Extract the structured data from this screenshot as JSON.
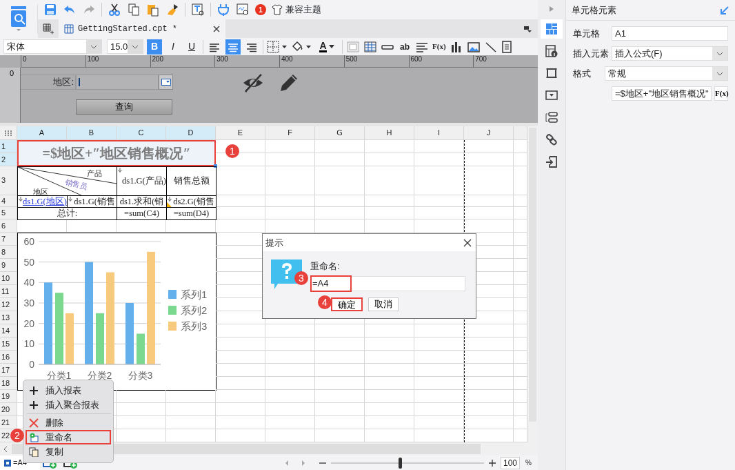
{
  "toolbar": {
    "badge": "1",
    "theme_button": "兼容主题"
  },
  "tabs": [
    {
      "label": "GettingStarted.cpt *",
      "selected": true
    }
  ],
  "format_bar": {
    "font": "宋体",
    "font_size": "15.0",
    "style_buttons": [
      {
        "kind": "bold",
        "label": "B",
        "selected": true
      },
      {
        "kind": "italic",
        "label": "I",
        "selected": false
      },
      {
        "kind": "underline",
        "label": "U",
        "selected": false
      }
    ],
    "align_buttons": [
      {
        "kind": "left",
        "selected": false
      },
      {
        "kind": "center",
        "selected": true
      },
      {
        "kind": "right",
        "selected": false
      }
    ],
    "font_color_label": "A",
    "text_label": "ab",
    "formula_label": "F(x)"
  },
  "ruler": {
    "ticks": [
      "0",
      "100",
      "200",
      "300",
      "400",
      "500",
      "600",
      "700"
    ],
    "vertical_ticks": [
      "0"
    ]
  },
  "parameter_pane": {
    "label": "地区:",
    "query_button": "查询"
  },
  "sheet": {
    "columns": [
      {
        "label": "A",
        "selected": true
      },
      {
        "label": "B",
        "selected": true
      },
      {
        "label": "C",
        "selected": true
      },
      {
        "label": "D",
        "selected": true
      },
      {
        "label": "E",
        "selected": false
      },
      {
        "label": "F",
        "selected": false
      },
      {
        "label": "G",
        "selected": false
      },
      {
        "label": "H",
        "selected": false
      },
      {
        "label": "I",
        "selected": false
      },
      {
        "label": "J",
        "selected": false
      }
    ],
    "rows": [
      {
        "label": "1",
        "selected": true
      },
      {
        "label": "2",
        "selected": true
      },
      {
        "label": "3",
        "selected": false
      },
      {
        "label": "4",
        "selected": false
      },
      {
        "label": "5",
        "selected": false
      },
      {
        "label": "6",
        "selected": false
      },
      {
        "label": "7",
        "selected": false
      },
      {
        "label": "8",
        "selected": false
      },
      {
        "label": "9",
        "selected": false
      },
      {
        "label": "10",
        "selected": false
      },
      {
        "label": "11",
        "selected": false
      },
      {
        "label": "12",
        "selected": false
      },
      {
        "label": "13",
        "selected": false
      },
      {
        "label": "14",
        "selected": false
      },
      {
        "label": "15",
        "selected": false
      },
      {
        "label": "16",
        "selected": false
      },
      {
        "label": "17",
        "selected": false
      },
      {
        "label": "18",
        "selected": false
      },
      {
        "label": "19",
        "selected": false
      },
      {
        "label": "20",
        "selected": false
      },
      {
        "label": "21",
        "selected": false
      },
      {
        "label": "22",
        "selected": false
      }
    ],
    "cells": [
      {
        "kind": "title",
        "text": "=$地区+″地区销售概况″",
        "selected": true
      },
      {
        "kind": "diagonal",
        "labels": [
          "产品",
          "销售员",
          "地区"
        ]
      },
      {
        "kind": "plain",
        "text": "ds1.G(产品)",
        "expand": true
      },
      {
        "kind": "plain",
        "text": "销售总额",
        "expand": false
      },
      {
        "kind": "link",
        "text": "ds1.G(地区)",
        "expand": true
      },
      {
        "kind": "plain",
        "text": "ds1.G(销售",
        "expand": true
      },
      {
        "kind": "plain",
        "text": "ds1.求和(销",
        "expand": false
      },
      {
        "kind": "plain",
        "text": "ds2.G(销售",
        "expand": true,
        "flag": true
      },
      {
        "kind": "plain",
        "text": "总计:",
        "expand": false
      },
      {
        "kind": "plain",
        "text": "=sum(C4)",
        "expand": false
      },
      {
        "kind": "plain",
        "text": "=sum(D4)",
        "expand": false
      }
    ],
    "chart_data": {
      "type": "bar",
      "categories": [
        "分类1",
        "分类2",
        "分类3"
      ],
      "series": [
        {
          "name": "系列1",
          "color": "#63b0ec",
          "values": [
            40,
            50,
            30
          ]
        },
        {
          "name": "系列2",
          "color": "#7ad98f",
          "values": [
            35,
            25,
            15
          ]
        },
        {
          "name": "系列3",
          "color": "#f7ca7e",
          "values": [
            25,
            45,
            55
          ]
        }
      ],
      "ylim": [
        0,
        60
      ],
      "yticks": [
        0,
        10,
        20,
        30,
        40,
        50,
        60
      ],
      "grid": true,
      "legend": true
    }
  },
  "context_menu": [
    {
      "kind": "insert",
      "label": "插入报表",
      "highlighted": false
    },
    {
      "kind": "insert",
      "label": "插入聚合报表",
      "highlighted": false
    },
    {
      "kind": "separator"
    },
    {
      "kind": "delete",
      "label": "删除",
      "highlighted": false
    },
    {
      "kind": "rename",
      "label": "重命名",
      "highlighted": true
    },
    {
      "kind": "copy",
      "label": "复制",
      "highlighted": false
    }
  ],
  "dialog": {
    "title": "提示",
    "label": "重命名:",
    "value": "=A4",
    "value_highlighted": true,
    "buttons": [
      {
        "label": "确定",
        "highlighted": true
      },
      {
        "label": "取消",
        "highlighted": false
      }
    ]
  },
  "step_markers": [
    {
      "label": "1"
    },
    {
      "label": "2"
    },
    {
      "label": "3"
    },
    {
      "label": "4"
    }
  ],
  "right_panel": {
    "strip": [
      {
        "kind": "cell",
        "selected": true
      },
      {
        "kind": "info",
        "selected": false
      },
      {
        "kind": "border",
        "selected": false
      },
      {
        "kind": "widget",
        "selected": false
      },
      {
        "kind": "layout",
        "selected": false
      },
      {
        "kind": "link",
        "selected": false
      },
      {
        "kind": "import",
        "selected": false
      }
    ],
    "title": "单元格元素",
    "fields": [
      {
        "kind": "text",
        "label": "单元格",
        "value": "A1"
      },
      {
        "kind": "select",
        "label": "插入元素",
        "value": "插入公式(F)"
      },
      {
        "kind": "select",
        "label": "格式",
        "value": "常规"
      },
      {
        "kind": "formula",
        "value": "=$地区+\"地区销售概况\"",
        "button": "F(x)"
      }
    ]
  },
  "status_bar": {
    "sheet_tab": {
      "label": "=A4",
      "selected": true
    },
    "zoom": {
      "level": 0.45,
      "value": "100",
      "unit": "%"
    }
  }
}
